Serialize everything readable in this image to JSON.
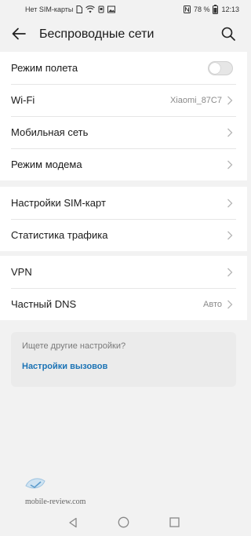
{
  "status_bar": {
    "carrier": "Нет SIM-карты",
    "battery_percent": "78 %",
    "time": "12:13"
  },
  "header": {
    "title": "Беспроводные сети"
  },
  "groups": [
    {
      "items": [
        {
          "label": "Режим полета",
          "control": "toggle",
          "toggle_on": false
        },
        {
          "label": "Wi-Fi",
          "value": "Xiaomi_87C7"
        },
        {
          "label": "Мобильная сеть"
        },
        {
          "label": "Режим модема"
        }
      ]
    },
    {
      "items": [
        {
          "label": "Настройки SIM-карт"
        },
        {
          "label": "Статистика трафика"
        }
      ]
    },
    {
      "items": [
        {
          "label": "VPN"
        },
        {
          "label": "Частный DNS",
          "value": "Авто"
        }
      ]
    }
  ],
  "suggestion": {
    "question": "Ищете другие настройки?",
    "link": "Настройки вызовов"
  },
  "watermark": {
    "text": "mobile-review.com"
  },
  "colors": {
    "background": "#f2f2f2",
    "card": "#ffffff",
    "accent_link": "#1b73b5",
    "secondary_text": "#8a8a8a"
  }
}
